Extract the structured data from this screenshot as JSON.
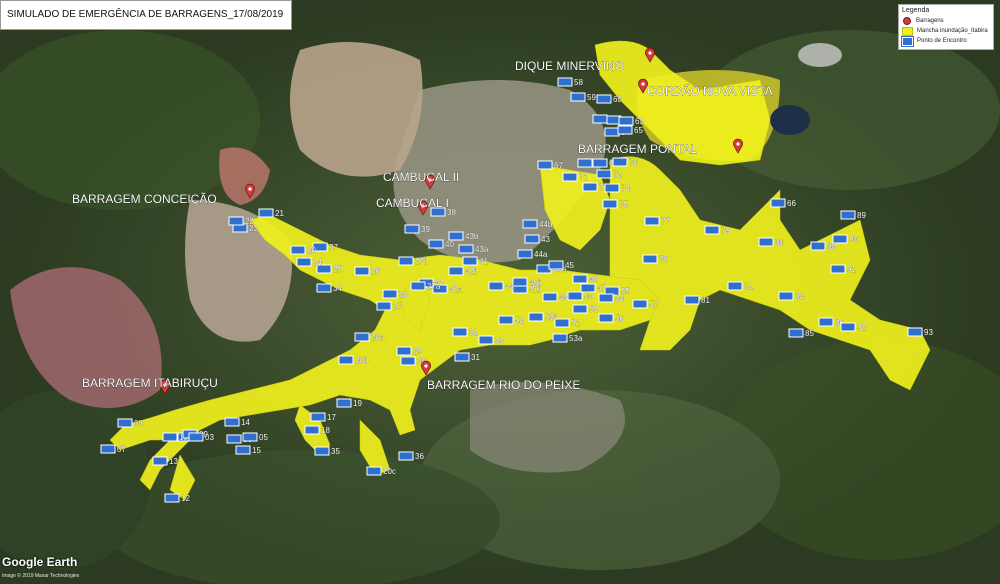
{
  "title": "SIMULADO DE EMERGÊNCIA DE BARRAGENS_17/08/2019",
  "legend": {
    "title": "Legenda",
    "items": [
      {
        "label": "Barragens",
        "icon": "dam-pin-icon"
      },
      {
        "label": "Mancha inundação_Itabira",
        "icon": "flood-area-icon"
      },
      {
        "label": "Ponto de Encontro",
        "icon": "meeting-point-icon"
      }
    ]
  },
  "colors": {
    "flood": "#f0f01e",
    "pin": "#d23c3c",
    "meeting": "#2f6fd0",
    "label": "#ffffff"
  },
  "dams": [
    {
      "label": "DIQUE MINERVINO"
    },
    {
      "label": "CORDÃO NOVA VISTA"
    },
    {
      "label": "BARRAGEM PONTAL"
    },
    {
      "label": "CAMBUCAL II"
    },
    {
      "label": "CAMBUCAL I"
    },
    {
      "label": "BARRAGEM CONCEIÇÃO"
    },
    {
      "label": "BARRAGEM ITABIRUÇU"
    },
    {
      "label": "BARRAGEM RIO DO PEIXE"
    }
  ],
  "meeting_points": [
    "58",
    "59",
    "60",
    "61",
    "62",
    "63",
    "64",
    "65",
    "66",
    "67",
    "68",
    "69",
    "70",
    "71",
    "72",
    "73",
    "74",
    "75",
    "77",
    "78",
    "79",
    "80",
    "81",
    "82",
    "84",
    "85",
    "86",
    "88",
    "89",
    "90",
    "91",
    "92",
    "93",
    "57",
    "56",
    "55",
    "54",
    "53",
    "53a",
    "53b",
    "52",
    "51",
    "51b",
    "50",
    "49",
    "48",
    "47",
    "46a",
    "46b",
    "45",
    "44",
    "44a",
    "44b",
    "43",
    "43a",
    "43b",
    "42",
    "42a",
    "42b",
    "41",
    "40",
    "39",
    "38",
    "37",
    "36",
    "35",
    "34",
    "33",
    "32",
    "31",
    "30",
    "29",
    "28",
    "27",
    "27a",
    "27b",
    "26",
    "25",
    "24",
    "23",
    "22",
    "21",
    "20",
    "20a",
    "20b",
    "20c",
    "19",
    "18",
    "17",
    "15",
    "14",
    "13",
    "12",
    "11",
    "10",
    "09",
    "08",
    "07",
    "06",
    "05",
    "03",
    "02",
    "01",
    "36b",
    "36a",
    "06a"
  ],
  "attribution": {
    "logo": "Google Earth",
    "credit": "Image © 2019 Maxar Technologies"
  }
}
